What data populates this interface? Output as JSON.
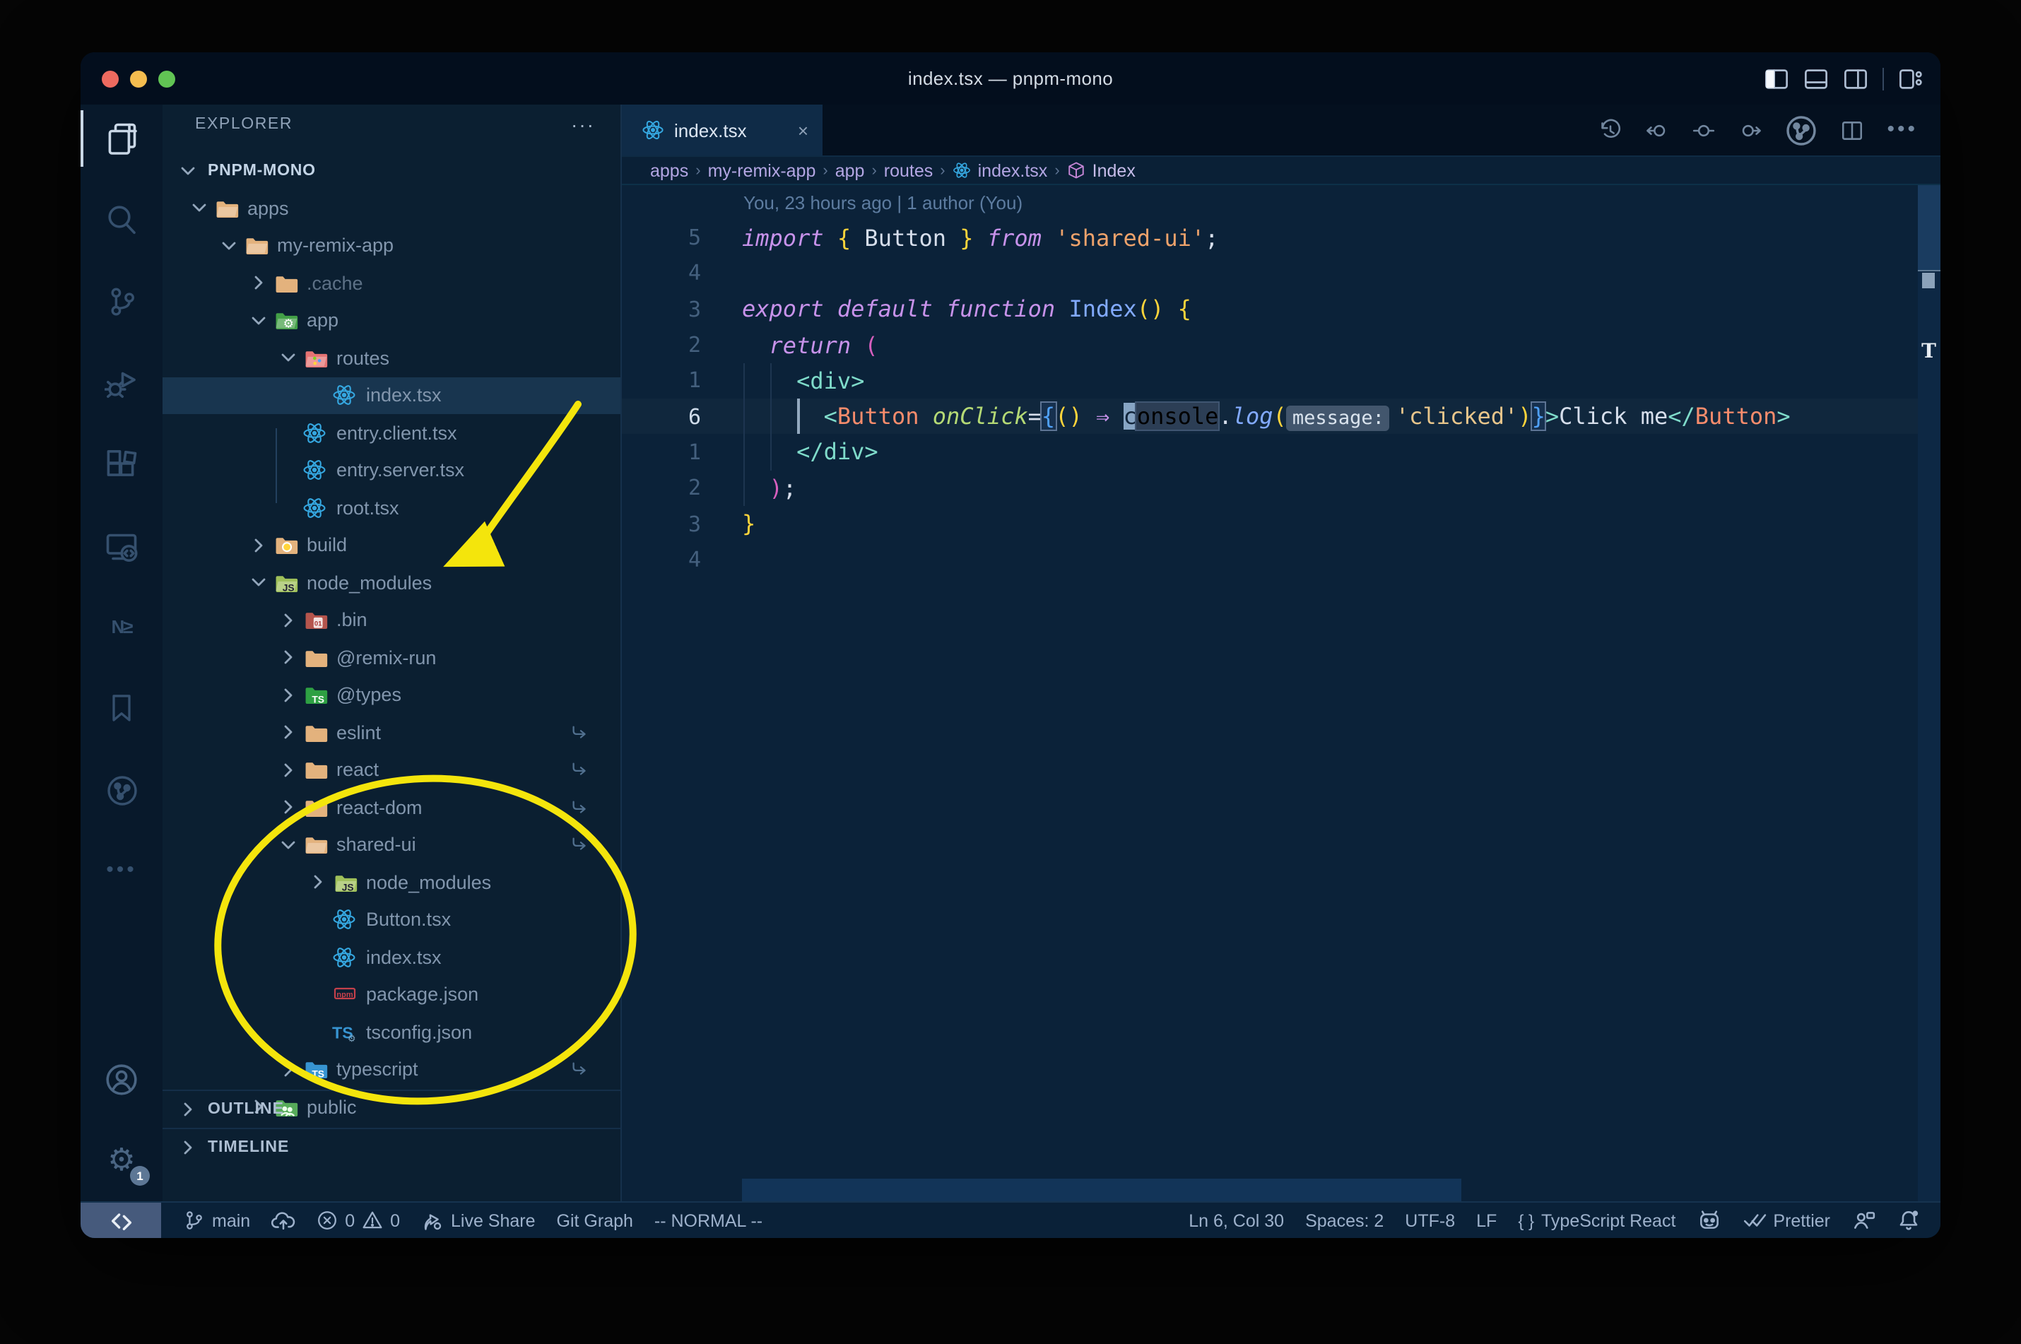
{
  "window": {
    "title": "index.tsx — pnpm-mono"
  },
  "colors": {
    "annotation_yellow": "#f4e50c",
    "accent_blue": "#2f86d5",
    "editor_bg": "#0b2239",
    "sidebar_bg": "#0b1f31"
  },
  "titlebar": {
    "layout_icons": [
      {
        "name": "layout-sidebar-left-icon",
        "active": true
      },
      {
        "name": "layout-panel-icon"
      },
      {
        "name": "layout-sidebar-right-icon"
      },
      {
        "name": "layout-customize-icon"
      }
    ]
  },
  "activity_bar": {
    "items": [
      {
        "name": "explorer",
        "icon": "files-icon",
        "active": true
      },
      {
        "name": "search",
        "icon": "search-icon"
      },
      {
        "name": "source-control",
        "icon": "source-control-icon"
      },
      {
        "name": "run-debug",
        "icon": "run-debug-icon"
      },
      {
        "name": "extensions",
        "icon": "extensions-icon"
      },
      {
        "name": "remote-explorer",
        "icon": "remote-explorer-icon"
      },
      {
        "name": "nx-console",
        "icon": "nx-console-icon"
      },
      {
        "name": "bookmarks",
        "icon": "bookmark-icon"
      },
      {
        "name": "git-graph",
        "icon": "git-graph-circle-icon"
      },
      {
        "name": "more-views",
        "icon": "ellipsis-icon"
      }
    ],
    "bottom": [
      {
        "name": "account",
        "icon": "account-icon"
      },
      {
        "name": "settings",
        "icon": "gear-icon",
        "badge": "1"
      }
    ]
  },
  "sidebar": {
    "header": "EXPLORER",
    "more": "···",
    "root": "PNPM-MONO",
    "tree": [
      {
        "label": "apps",
        "level": 1,
        "icon": "folder-open",
        "chevron": "down"
      },
      {
        "label": "my-remix-app",
        "level": 2,
        "icon": "folder-open",
        "chevron": "down"
      },
      {
        "label": ".cache",
        "level": 3,
        "icon": "folder",
        "chevron": "right",
        "dim": true
      },
      {
        "label": "app",
        "level": 3,
        "icon": "folder-app",
        "chevron": "down"
      },
      {
        "label": "routes",
        "level": 4,
        "icon": "folder-routes",
        "chevron": "down"
      },
      {
        "label": "index.tsx",
        "level": 5,
        "icon": "react",
        "selected": true
      },
      {
        "label": "entry.client.tsx",
        "level": 4,
        "icon": "react"
      },
      {
        "label": "entry.server.tsx",
        "level": 4,
        "icon": "react"
      },
      {
        "label": "root.tsx",
        "level": 4,
        "icon": "react"
      },
      {
        "label": "build",
        "level": 3,
        "icon": "folder-build",
        "chevron": "right"
      },
      {
        "label": "node_modules",
        "level": 3,
        "icon": "folder-node",
        "chevron": "down"
      },
      {
        "label": ".bin",
        "level": 4,
        "icon": "folder-binary",
        "chevron": "right"
      },
      {
        "label": "@remix-run",
        "level": 4,
        "icon": "folder",
        "chevron": "right"
      },
      {
        "label": "@types",
        "level": 4,
        "icon": "folder-types",
        "chevron": "right"
      },
      {
        "label": "eslint",
        "level": 4,
        "icon": "folder",
        "chevron": "right",
        "symlink": true
      },
      {
        "label": "react",
        "level": 4,
        "icon": "folder",
        "chevron": "right",
        "symlink": true
      },
      {
        "label": "react-dom",
        "level": 4,
        "icon": "folder",
        "chevron": "right",
        "symlink": true
      },
      {
        "label": "shared-ui",
        "level": 4,
        "icon": "folder-open",
        "chevron": "down",
        "symlink": true
      },
      {
        "label": "node_modules",
        "level": 5,
        "icon": "folder-node",
        "chevron": "right"
      },
      {
        "label": "Button.tsx",
        "level": 5,
        "icon": "react"
      },
      {
        "label": "index.tsx",
        "level": 5,
        "icon": "react"
      },
      {
        "label": "package.json",
        "level": 5,
        "icon": "npm"
      },
      {
        "label": "tsconfig.json",
        "level": 5,
        "icon": "ts-config"
      },
      {
        "label": "typescript",
        "level": 4,
        "icon": "folder-ts",
        "chevron": "right",
        "symlink": true
      },
      {
        "label": "public",
        "level": 3,
        "icon": "folder-public",
        "chevron": "right"
      }
    ],
    "sections": [
      "OUTLINE",
      "TIMELINE"
    ]
  },
  "editor": {
    "tab": {
      "label": "index.tsx",
      "icon": "react-icon",
      "close": "×"
    },
    "actions": [
      "history-icon",
      "nav-back-icon",
      "nav-location-icon",
      "nav-forward-icon",
      "git-graph-circle-icon",
      "split-editor-icon",
      "ellipsis-icon"
    ],
    "breadcrumbs": [
      {
        "label": "apps"
      },
      {
        "label": "my-remix-app"
      },
      {
        "label": "app"
      },
      {
        "label": "routes"
      },
      {
        "label": "index.tsx",
        "icon": "react"
      },
      {
        "label": "Index",
        "icon": "symbol-cube"
      }
    ],
    "blame": "You, 23 hours ago | 1 author (You)",
    "lines": [
      {
        "n": "5",
        "tokens": [
          {
            "t": "import",
            "c": "kw"
          },
          {
            "t": " ",
            "c": "plain"
          },
          {
            "t": "{",
            "c": "gold"
          },
          {
            "t": " Button ",
            "c": "plain"
          },
          {
            "t": "}",
            "c": "gold"
          },
          {
            "t": " ",
            "c": "plain"
          },
          {
            "t": "from",
            "c": "kw"
          },
          {
            "t": " ",
            "c": "plain"
          },
          {
            "t": "'shared-ui'",
            "c": "str2"
          },
          {
            "t": ";",
            "c": "plain"
          }
        ]
      },
      {
        "n": "4",
        "tokens": []
      },
      {
        "n": "3",
        "tokens": [
          {
            "t": "export",
            "c": "kw"
          },
          {
            "t": " ",
            "c": "plain"
          },
          {
            "t": "default",
            "c": "kw"
          },
          {
            "t": " ",
            "c": "plain"
          },
          {
            "t": "function",
            "c": "kw"
          },
          {
            "t": " ",
            "c": "plain"
          },
          {
            "t": "Index",
            "c": "fn"
          },
          {
            "t": "()",
            "c": "gold"
          },
          {
            "t": " ",
            "c": "plain"
          },
          {
            "t": "{",
            "c": "gold"
          }
        ]
      },
      {
        "n": "2",
        "tokens": [
          {
            "t": "  ",
            "c": "plain"
          },
          {
            "t": "return",
            "c": "kw"
          },
          {
            "t": " ",
            "c": "plain"
          },
          {
            "t": "(",
            "c": "pinkb"
          }
        ]
      },
      {
        "n": "1",
        "tokens": [
          {
            "t": "    ",
            "c": "plain"
          },
          {
            "t": "<div>",
            "c": "teal"
          }
        ]
      },
      {
        "n": "6",
        "current": true,
        "tokens": [
          {
            "t": "      ",
            "c": "plain"
          },
          {
            "t": "<",
            "c": "teal"
          },
          {
            "t": "Button",
            "c": "coral"
          },
          {
            "t": " ",
            "c": "plain"
          },
          {
            "t": "onClick",
            "c": "attr"
          },
          {
            "t": "=",
            "c": "plain"
          },
          {
            "t": "{",
            "c": "blueb"
          },
          {
            "t": "()",
            "c": "gold"
          },
          {
            "t": " ",
            "c": "plain"
          },
          {
            "t": "⇒",
            "c": "arrow"
          },
          {
            "t": " ",
            "c": "plain"
          },
          {
            "t": "c",
            "c": "cursor"
          },
          {
            "t": "onsole",
            "c": "occ"
          },
          {
            "t": ".",
            "c": "plain"
          },
          {
            "t": "log",
            "c": "fni"
          },
          {
            "t": "(",
            "c": "gold"
          },
          {
            "t": "message:",
            "c": "inlay"
          },
          {
            "t": "'clicked'",
            "c": "str"
          },
          {
            "t": ")",
            "c": "gold"
          },
          {
            "t": "}",
            "c": "blueb"
          },
          {
            "t": ">",
            "c": "teal"
          },
          {
            "t": "Click me",
            "c": "plain"
          },
          {
            "t": "</",
            "c": "teal"
          },
          {
            "t": "Button",
            "c": "coral"
          },
          {
            "t": ">",
            "c": "teal"
          }
        ]
      },
      {
        "n": "1",
        "tokens": [
          {
            "t": "    ",
            "c": "plain"
          },
          {
            "t": "</div>",
            "c": "teal"
          }
        ]
      },
      {
        "n": "2",
        "tokens": [
          {
            "t": "  ",
            "c": "plain"
          },
          {
            "t": ")",
            "c": "pinkb"
          },
          {
            "t": ";",
            "c": "plain"
          }
        ]
      },
      {
        "n": "3",
        "tokens": [
          {
            "t": "}",
            "c": "gold"
          }
        ]
      },
      {
        "n": "4",
        "tokens": []
      }
    ]
  },
  "status_bar": {
    "left": [
      {
        "name": "branch",
        "icon": "branch-icon",
        "label": "main"
      },
      {
        "name": "sync",
        "icon": "cloud-upload-icon",
        "label": ""
      },
      {
        "name": "problems",
        "icon": "error-icon",
        "label": "0",
        "icon2": "warning-icon",
        "label2": "0"
      },
      {
        "name": "live-share",
        "icon": "live-share-icon",
        "label": "Live Share"
      },
      {
        "name": "git-graph",
        "label": "Git Graph"
      },
      {
        "name": "vim-mode",
        "label": "-- NORMAL --"
      }
    ],
    "right": [
      {
        "name": "cursor-position",
        "label": "Ln 6, Col 30"
      },
      {
        "name": "indentation",
        "label": "Spaces: 2"
      },
      {
        "name": "encoding",
        "label": "UTF-8"
      },
      {
        "name": "eol",
        "label": "LF"
      },
      {
        "name": "language-mode",
        "icon": "braces-icon",
        "label": "TypeScript React"
      },
      {
        "name": "extension-face",
        "icon": "robot-icon",
        "label": ""
      },
      {
        "name": "prettier",
        "icon": "double-check-icon",
        "label": "Prettier"
      },
      {
        "name": "feedback",
        "icon": "feedback-icon",
        "label": ""
      },
      {
        "name": "notifications",
        "icon": "bell-icon",
        "label": ""
      }
    ]
  }
}
